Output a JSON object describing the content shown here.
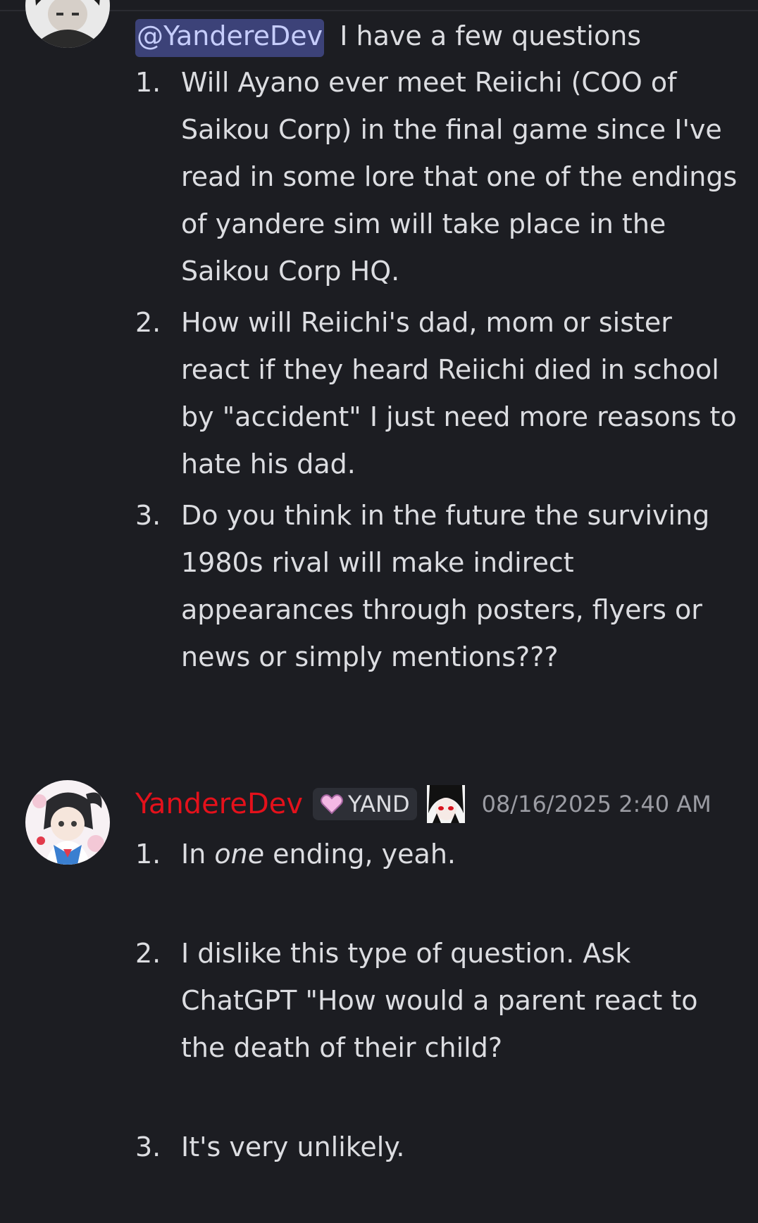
{
  "message1": {
    "mention": "@YandereDev",
    "intro": "I have a few questions",
    "items": [
      {
        "num": "1.",
        "text": "Will Ayano ever meet Reiichi (COO of Saikou Corp) in the final game since I've read in some lore that one of the endings of yandere sim will take place in the Saikou Corp HQ."
      },
      {
        "num": "2.",
        "text": "How will Reiichi's dad, mom or sister react if they heard Reiichi died in school by \"accident\" I just need more reasons to hate his dad."
      },
      {
        "num": "3.",
        "text": "Do you think in the future  the surviving 1980s rival will make indirect appearances through posters, flyers or news or simply mentions???"
      }
    ]
  },
  "message2": {
    "username": "YandereDev",
    "username_color": "#e4111b",
    "tag": "YAND",
    "tag_icon": "heart-icon",
    "role_icon": "red-eyed-character-icon",
    "timestamp": "08/16/2025 2:40 AM",
    "items": [
      {
        "num": "1.",
        "text_before": "In ",
        "text_emphasis": "one",
        "text_after": " ending, yeah."
      },
      {
        "num": "2.",
        "text": "I dislike this type of question. Ask ChatGPT \"How would a parent react to the death of their child?"
      },
      {
        "num": "3.",
        "text": "It's very unlikely."
      }
    ]
  }
}
